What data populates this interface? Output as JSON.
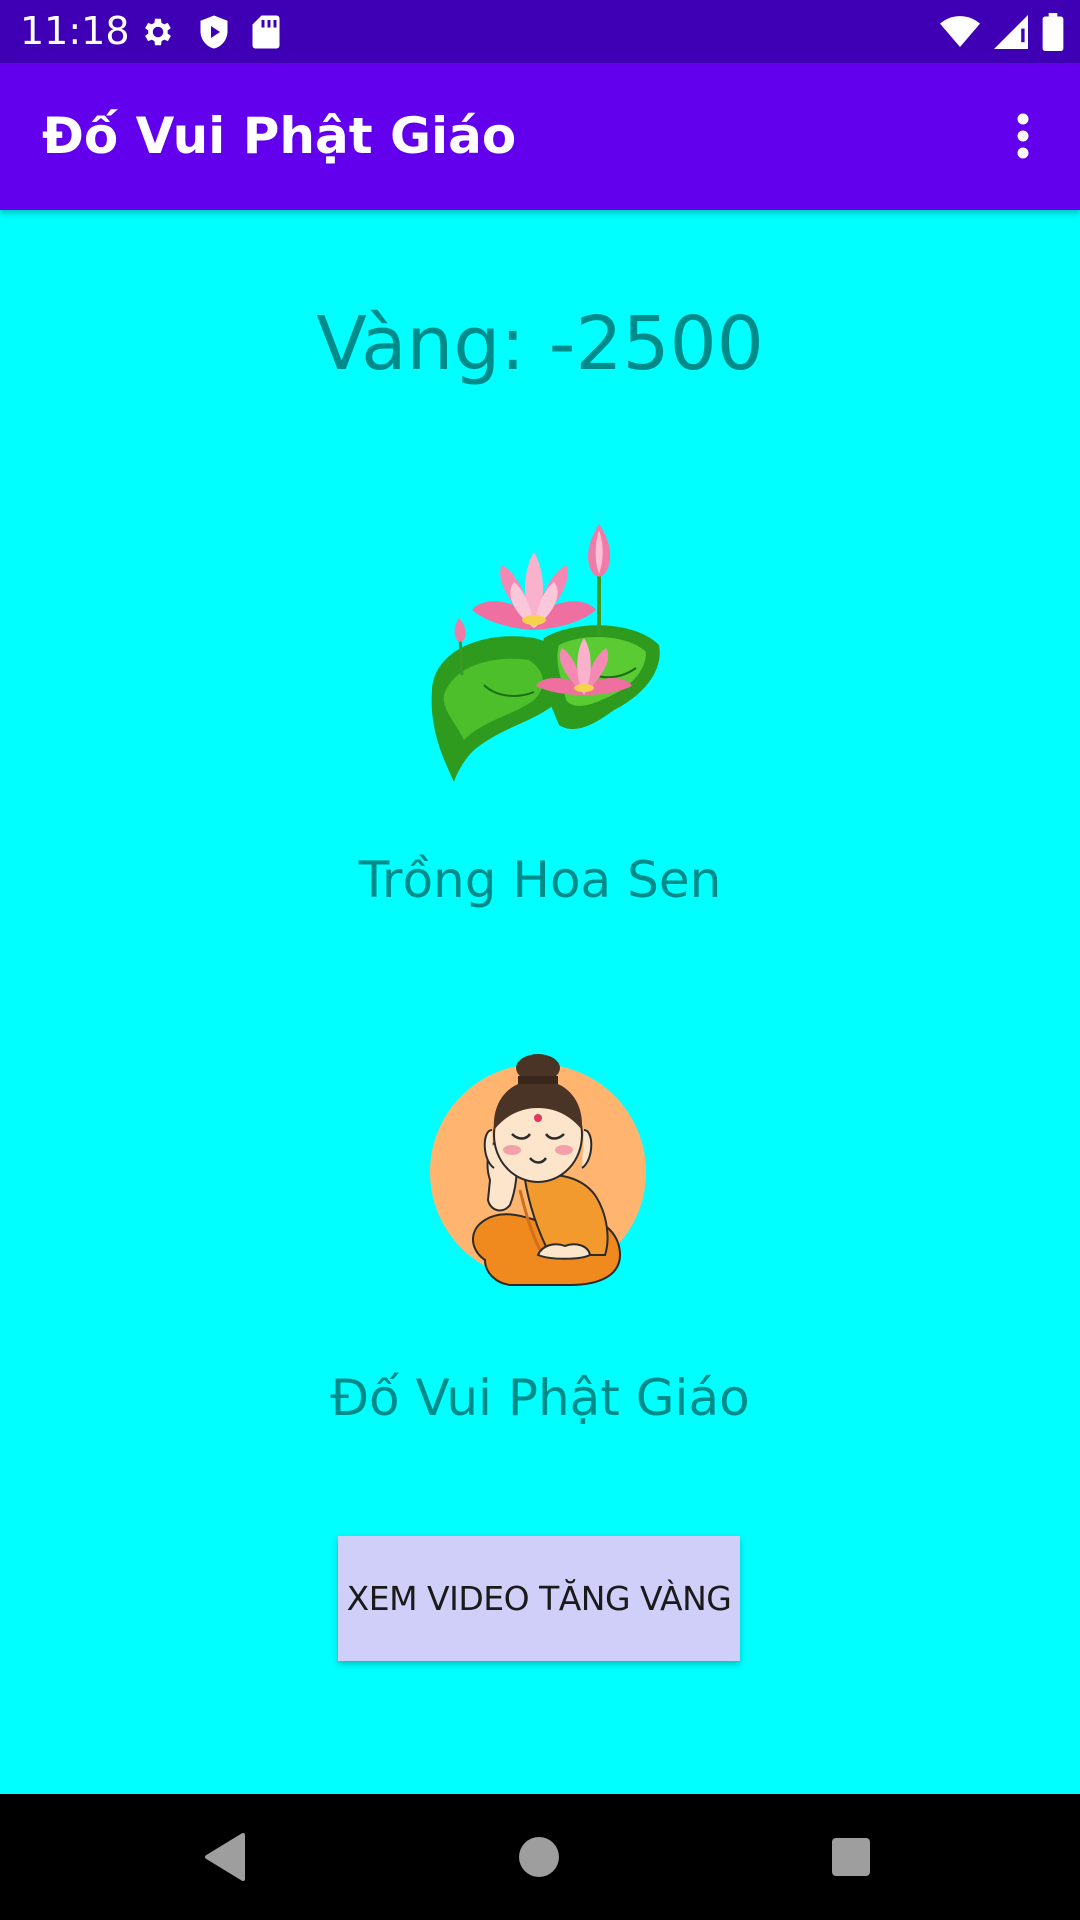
{
  "status_bar": {
    "time": "11:18",
    "left_icons": [
      "gear-icon",
      "shield-play-icon",
      "sd-card-icon"
    ],
    "right_icons": [
      "wifi-icon",
      "signal-icon",
      "battery-icon"
    ]
  },
  "app_bar": {
    "title": "Đố Vui Phật Giáo",
    "menu_icon": "overflow-menu-icon"
  },
  "main": {
    "gold_text": "Vàng: -2500",
    "lotus_label": "Trồng Hoa Sen",
    "quiz_label": "Đố Vui Phật Giáo",
    "video_button_label": "XEM VIDEO TĂNG VÀNG"
  },
  "nav_bar": {
    "buttons": [
      "back-icon",
      "home-icon",
      "recents-icon"
    ]
  },
  "colors": {
    "status_bar": "#3F00B5",
    "app_bar": "#6200EE",
    "background": "#00FFFF",
    "label_text": "#008B8B",
    "button_bg": "#CFCFFA",
    "nav_bar": "#000000"
  }
}
